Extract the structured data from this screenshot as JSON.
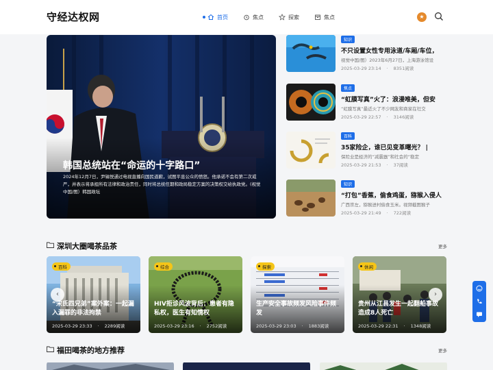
{
  "header": {
    "logo": "守经达权网",
    "nav": [
      {
        "label": "首页",
        "icon": "home-icon",
        "active": true
      },
      {
        "label": "焦点",
        "icon": "alarm-icon",
        "active": false
      },
      {
        "label": "探索",
        "icon": "star-icon",
        "active": false
      },
      {
        "label": "焦点",
        "icon": "box-icon",
        "active": false
      }
    ],
    "avatar_glyph": "★"
  },
  "hero": {
    "title": "韩国总统站在“命运的十字路口”",
    "desc": "2024年12月7日，尹锡悦通过电视直播向国民道歉，试图平息公众的愤怒。他承诺不会有第二次戒严，并表示将承担所有法律和政治责任，同时将总统任期和政局稳定方案的决策权交给执政党。(视觉中国/图）韩国政坛"
  },
  "side": [
    {
      "tag": "知识",
      "title": "不只设置女性专用泳道/车厢/车位，",
      "summary": "视觉中国/图）2023年6月27日，上海游泳馆设",
      "date": "2025-03-29 23:14",
      "reads": "8351阅读"
    },
    {
      "tag": "焦点",
      "title": "“虹膜写真”火了：浪漫唯美，但安",
      "summary": "“虹膜写真”最近火了不少网友和商家在社交",
      "date": "2025-03-29 22:57",
      "reads": "3146阅读"
    },
    {
      "tag": "百科",
      "title": "35家险企，谁已见变革曙光？ |",
      "summary": "保险业是经济的“减震器”和社会的“稳定",
      "date": "2025-03-29 21:53",
      "reads": "37阅读"
    },
    {
      "tag": "知识",
      "title": "“打包”香蕉，偷食鸡蛋，猕猴入侵人",
      "summary": "广西崇左，猕猴进村偷食玉米。视频截图猴子",
      "date": "2025-03-29 21:49",
      "reads": "722阅读"
    }
  ],
  "section1": {
    "title": "深圳大圈喝茶品茶",
    "more": "更多"
  },
  "cards": [
    {
      "tag": "百科",
      "title": "“宋氏四兄弟”案外案：一起漏入漏罪的非法拘禁",
      "date": "2025-03-29 23:33",
      "reads": "2289阅读"
    },
    {
      "tag": "综合",
      "title": "HIV拒诊风波背后：患者有隐私权，医生有知情权",
      "date": "2025-03-29 23:16",
      "reads": "2752阅读"
    },
    {
      "tag": "探索",
      "title": "生产安全事故频发风险事件频发",
      "date": "2025-03-29 23:03",
      "reads": "1883阅读"
    },
    {
      "tag": "休闲",
      "title": "贵州从江县发生一起翻船事故造成8人死亡",
      "date": "2025-03-29 22:31",
      "reads": "1348阅读"
    }
  ],
  "section2": {
    "title": "福田喝茶的地方推荐",
    "more": "更多"
  },
  "arrows": {
    "left": "‹",
    "right": "›"
  },
  "colors": {
    "accent": "#1e6ee8",
    "tag_yellow": "#f5c518",
    "avatar": "#e58a2c"
  }
}
